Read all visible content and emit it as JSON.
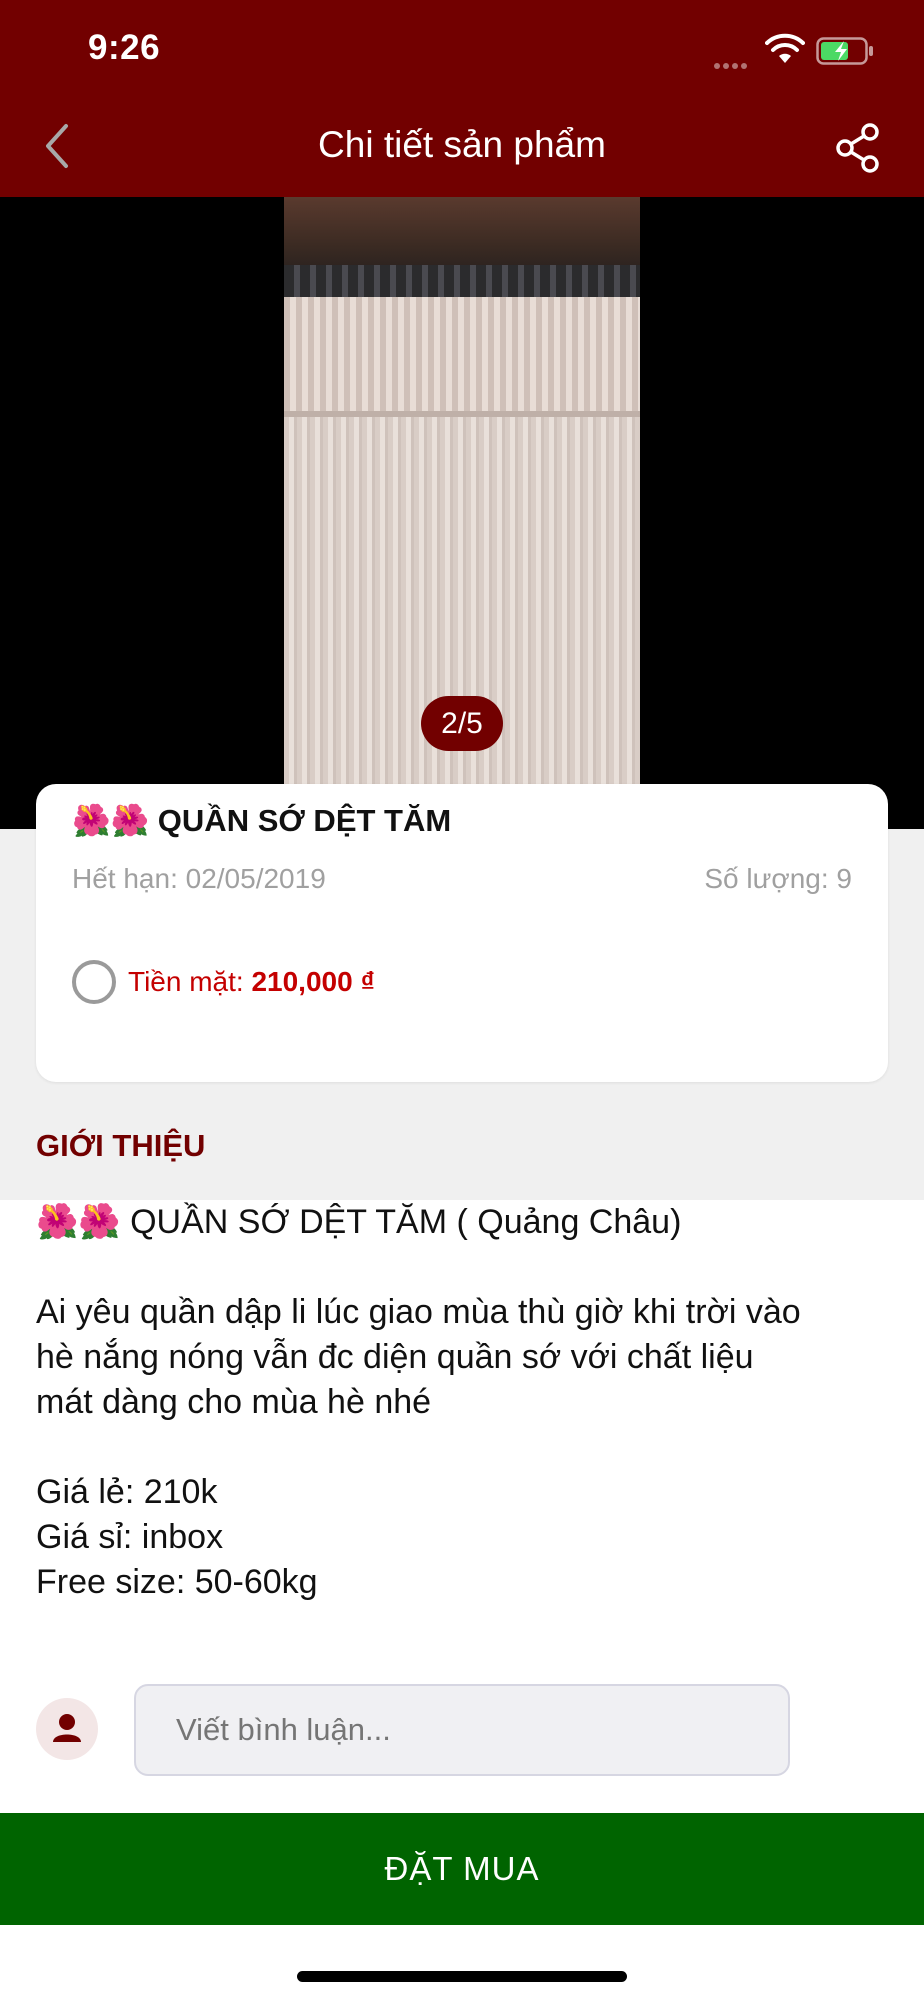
{
  "status_bar": {
    "time": "9:26"
  },
  "header": {
    "title": "Chi tiết sản phẩm"
  },
  "gallery": {
    "counter": "2/5"
  },
  "product": {
    "title": "🌺🌺 QUẦN SỚ DỆT TĂM",
    "expiry": "Hết hạn: 02/05/2019",
    "quantity": "Số lượng: 9",
    "payment_label": "Tiền mặt: ",
    "payment_price": "210,000 ₫"
  },
  "intro": {
    "header": "GIỚI THIỆU",
    "lines": [
      "🌺🌺 QUẦN SỚ DỆT TĂM ( Quảng Châu)",
      "",
      "Ai yêu quần dập li lúc giao mùa thù giờ khi trời vào",
      "hè nắng nóng vẫn đc diện quần sớ với chất liệu",
      "mát dàng cho mùa hè nhé",
      "",
      "Giá lẻ: 210k",
      "Giá sỉ: inbox",
      "Free size: 50-60kg"
    ]
  },
  "comment": {
    "placeholder": "Viết bình luận..."
  },
  "actions": {
    "order_label": "ĐẶT MUA"
  },
  "colors": {
    "brand": "#720000",
    "price_red": "#c40000",
    "order_green": "#006400"
  },
  "icons": {
    "back": "chevron-left-icon",
    "share": "share-icon",
    "avatar": "user-icon"
  }
}
